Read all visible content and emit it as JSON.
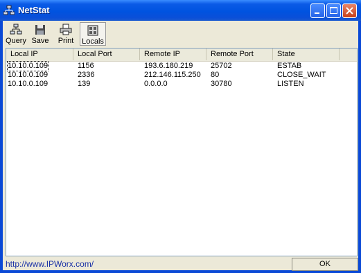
{
  "window": {
    "title": "NetStat"
  },
  "toolbar": {
    "buttons": [
      {
        "label": "Query",
        "icon": "query-icon"
      },
      {
        "label": "Save",
        "icon": "save-icon"
      },
      {
        "label": "Print",
        "icon": "print-icon"
      },
      {
        "label": "Locals",
        "icon": "locals-icon",
        "pressed": true
      }
    ]
  },
  "table": {
    "columns": [
      "Local IP",
      "Local Port",
      "Remote IP",
      "Remote Port",
      "State"
    ],
    "rows": [
      [
        "10.10.0.109",
        "1156",
        "193.6.180.219",
        "25702",
        "ESTAB"
      ],
      [
        "10.10.0.109",
        "2336",
        "212.146.115.250",
        "80",
        "CLOSE_WAIT"
      ],
      [
        "10.10.0.109",
        "139",
        "0.0.0.0",
        "30780",
        "LISTEN"
      ]
    ]
  },
  "statusbar": {
    "link": "http://www.IPWorx.com/",
    "ok_label": "OK"
  },
  "colors": {
    "titlebar": "#0053e0",
    "face": "#ece9d8",
    "link": "#1a31a6"
  }
}
